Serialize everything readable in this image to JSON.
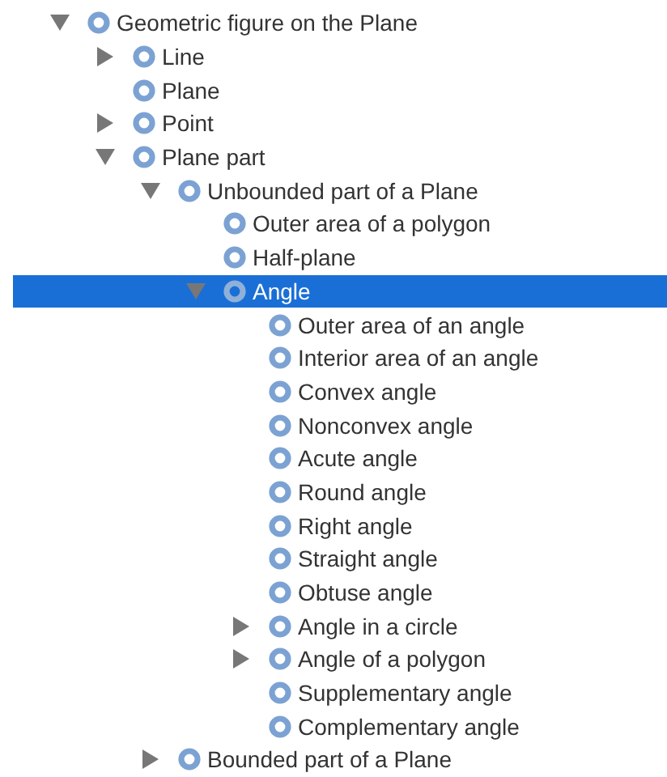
{
  "tree": [
    {
      "label": "Geometric figure on the Plane",
      "kind": "branch",
      "expanded": true,
      "selected": false,
      "children": [
        {
          "label": "Line",
          "kind": "branch",
          "expanded": false,
          "selected": false
        },
        {
          "label": "Plane",
          "kind": "leaf",
          "selected": false
        },
        {
          "label": "Point",
          "kind": "branch",
          "expanded": false,
          "selected": false
        },
        {
          "label": "Plane part",
          "kind": "branch",
          "expanded": true,
          "selected": false,
          "children": [
            {
              "label": "Unbounded part of a Plane",
              "kind": "branch",
              "expanded": true,
              "selected": false,
              "children": [
                {
                  "label": "Outer area of a polygon",
                  "kind": "leaf",
                  "selected": false
                },
                {
                  "label": "Half-plane",
                  "kind": "leaf",
                  "selected": false
                },
                {
                  "label": "Angle",
                  "kind": "branch",
                  "expanded": true,
                  "selected": true,
                  "children": [
                    {
                      "label": "Outer area of an angle",
                      "kind": "leaf",
                      "selected": false
                    },
                    {
                      "label": "Interior area of an angle",
                      "kind": "leaf",
                      "selected": false
                    },
                    {
                      "label": "Convex angle",
                      "kind": "leaf",
                      "selected": false
                    },
                    {
                      "label": "Nonconvex angle",
                      "kind": "leaf",
                      "selected": false
                    },
                    {
                      "label": "Acute angle",
                      "kind": "leaf",
                      "selected": false
                    },
                    {
                      "label": "Round angle",
                      "kind": "leaf",
                      "selected": false
                    },
                    {
                      "label": "Right angle",
                      "kind": "leaf",
                      "selected": false
                    },
                    {
                      "label": "Straight angle",
                      "kind": "leaf",
                      "selected": false
                    },
                    {
                      "label": "Obtuse angle",
                      "kind": "leaf",
                      "selected": false
                    },
                    {
                      "label": "Angle in a circle",
                      "kind": "branch",
                      "expanded": false,
                      "selected": false
                    },
                    {
                      "label": "Angle of a polygon",
                      "kind": "branch",
                      "expanded": false,
                      "selected": false
                    },
                    {
                      "label": "Supplementary angle",
                      "kind": "leaf",
                      "selected": false
                    },
                    {
                      "label": "Complementary angle",
                      "kind": "leaf",
                      "selected": false
                    }
                  ]
                }
              ]
            },
            {
              "label": "Bounded part of a Plane",
              "kind": "branch",
              "expanded": false,
              "selected": false
            }
          ]
        }
      ]
    }
  ]
}
